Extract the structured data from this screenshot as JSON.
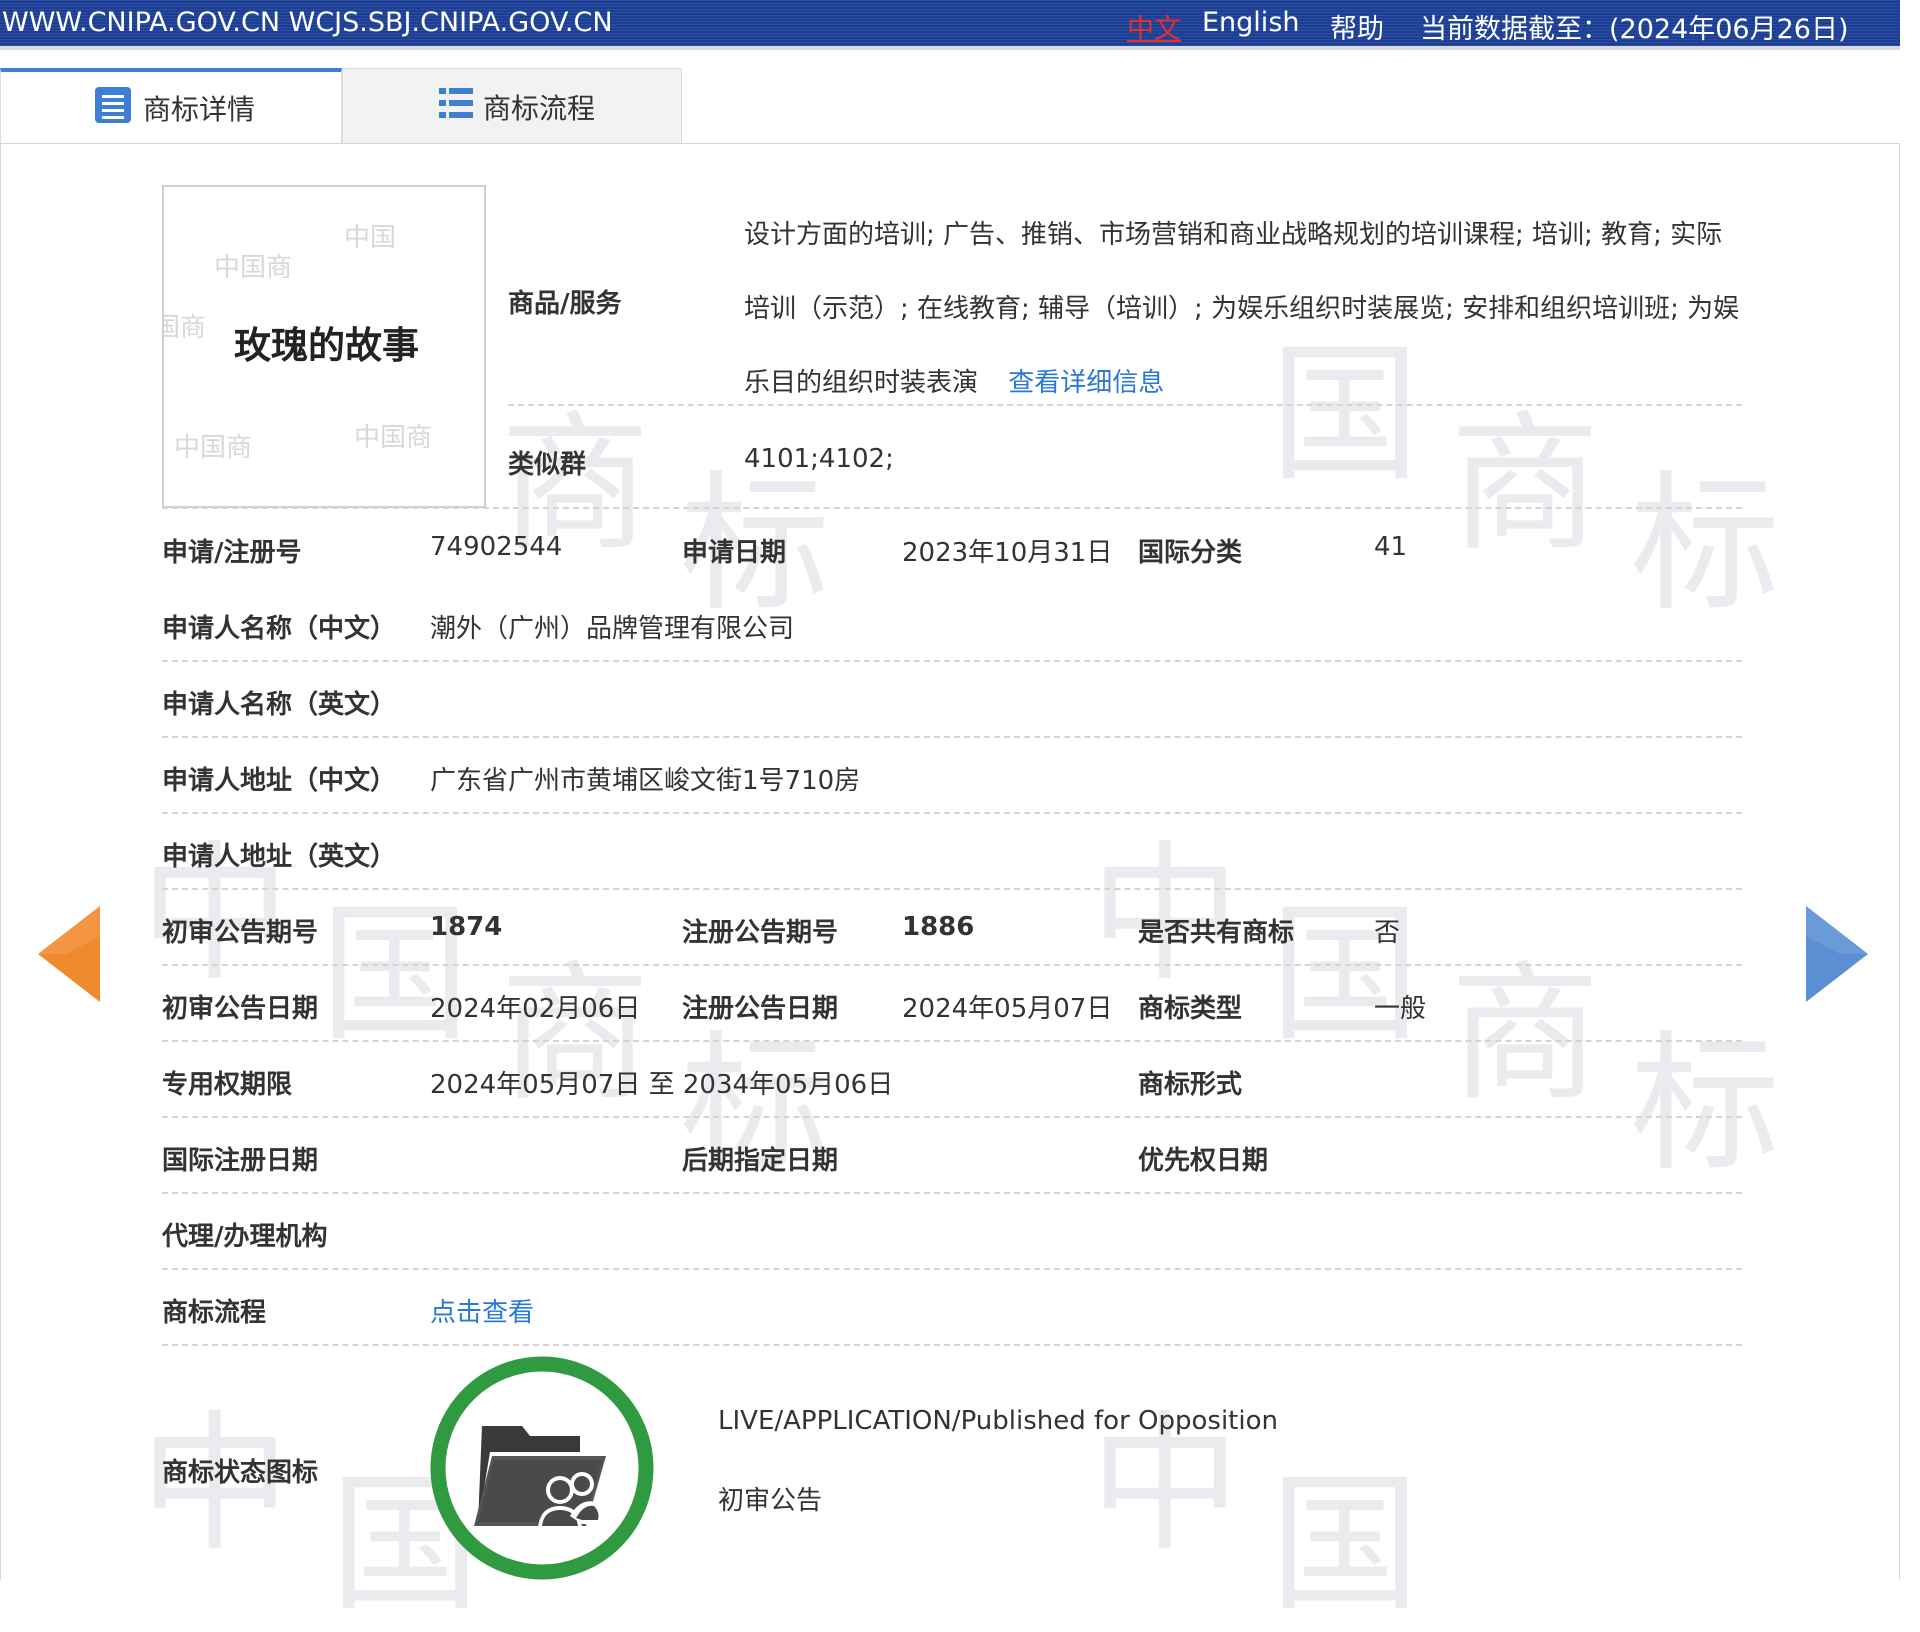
{
  "topbar": {
    "site": "WWW.CNIPA.GOV.CN WCJS.SBJ.CNIPA.GOV.CN",
    "lang_zh": "中文",
    "lang_en": "English",
    "help": "帮助",
    "data_date": "当前数据截至：(2024年06月26日)"
  },
  "tabs": [
    {
      "label": "商标详情",
      "icon": "list-doc-icon"
    },
    {
      "label": "商标流程",
      "icon": "list-icon"
    }
  ],
  "trademark_image": {
    "text": "玫瑰的故事"
  },
  "goods": {
    "label": "商品/服务",
    "value": "设计方面的培训; 广告、推销、市场营销和商业战略规划的培训课程; 培训; 教育; 实际培训（示范）; 在线教育; 辅导（培训）; 为娱乐组织时装展览; 安排和组织培训班; 为娱乐目的组织时装表演",
    "link": "查看详细信息"
  },
  "similar_group": {
    "label": "类似群",
    "value": "4101;4102;"
  },
  "fields": {
    "reg_no_label": "申请/注册号",
    "reg_no": "74902544",
    "app_date_label": "申请日期",
    "app_date": "2023年10月31日",
    "intl_class_label": "国际分类",
    "intl_class": "41",
    "applicant_cn_label": "申请人名称（中文）",
    "applicant_cn": "潮外（广州）品牌管理有限公司",
    "applicant_en_label": "申请人名称（英文）",
    "applicant_en": "",
    "address_cn_label": "申请人地址（中文）",
    "address_cn": "广东省广州市黄埔区峻文街1号710房",
    "address_en_label": "申请人地址（英文）",
    "address_en": "",
    "prelim_no_label": "初审公告期号",
    "prelim_no": "1874",
    "reg_pub_no_label": "注册公告期号",
    "reg_pub_no": "1886",
    "shared_label": "是否共有商标",
    "shared": "否",
    "prelim_date_label": "初审公告日期",
    "prelim_date": "2024年02月06日",
    "reg_pub_date_label": "注册公告日期",
    "reg_pub_date": "2024年05月07日",
    "tm_type_label": "商标类型",
    "tm_type": "一般",
    "term_label": "专用权期限",
    "term": "2024年05月07日 至 2034年05月06日",
    "tm_form_label": "商标形式",
    "tm_form": "",
    "intl_reg_date_label": "国际注册日期",
    "intl_reg_date": "",
    "later_date_label": "后期指定日期",
    "later_date": "",
    "priority_date_label": "优先权日期",
    "priority_date": "",
    "agent_label": "代理/办理机构",
    "agent": "",
    "process_label": "商标流程",
    "process_link": "点击查看",
    "status_label": "商标状态图标",
    "status_en": "LIVE/APPLICATION/Published for Opposition",
    "status_cn": "初审公告"
  },
  "nav": {
    "prev_icon": "arrow-left-icon",
    "next_icon": "arrow-right-icon"
  },
  "colors": {
    "topbar": "#1c3f95",
    "tab_accent": "#3d7fd4",
    "link": "#2a78d6",
    "prev_arrow": "#f08a2e",
    "next_arrow": "#5b8fd3",
    "status_ring": "#2f9a3f"
  }
}
